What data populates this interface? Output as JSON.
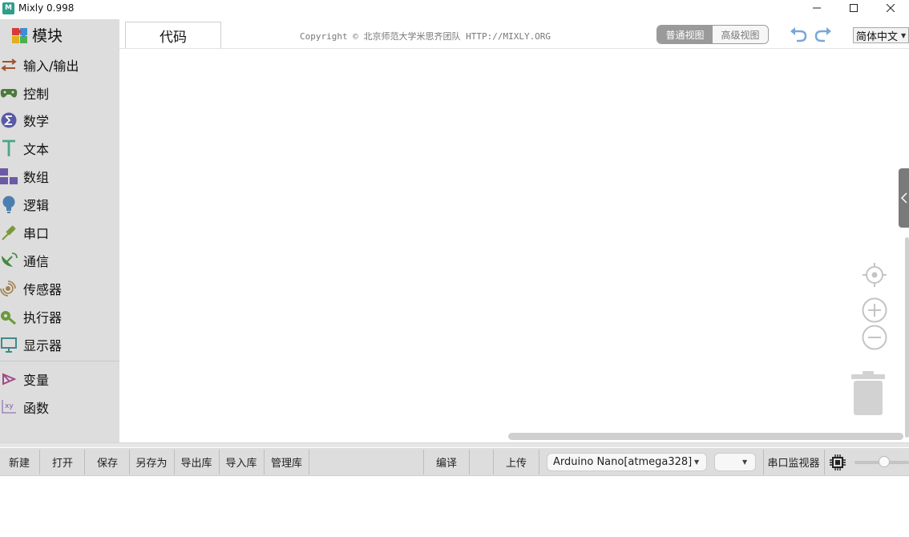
{
  "window": {
    "title": "Mixly 0.998",
    "icon": "mixly-logo-icon",
    "minimize_icon": "minimize-icon",
    "maximize_icon": "maximize-icon",
    "close_icon": "close-icon"
  },
  "sidebar": {
    "header_label": "模块",
    "header_icon": "puzzle-icon",
    "categories": [
      {
        "label": "输入/输出",
        "icon": "io-arrows-icon",
        "color": "#a0522d"
      },
      {
        "label": "控制",
        "icon": "gamepad-icon",
        "color": "#4a7a3a"
      },
      {
        "label": "数学",
        "icon": "sigma-icon",
        "color": "#5a5aa6"
      },
      {
        "label": "文本",
        "icon": "text-t-icon",
        "color": "#4ba58a"
      },
      {
        "label": "数组",
        "icon": "blocks-icon",
        "color": "#6b5aa6"
      },
      {
        "label": "逻辑",
        "icon": "bulb-icon",
        "color": "#4a7fb0"
      },
      {
        "label": "串口",
        "icon": "usb-cable-icon",
        "color": "#7a9a3a"
      },
      {
        "label": "通信",
        "icon": "satellite-dish-icon",
        "color": "#3f8a3f"
      },
      {
        "label": "传感器",
        "icon": "sensor-wave-icon",
        "color": "#a08050"
      },
      {
        "label": "执行器",
        "icon": "actuator-icon",
        "color": "#6a9a3a"
      },
      {
        "label": "显示器",
        "icon": "monitor-icon",
        "color": "#3f8a8a"
      },
      {
        "label": "变量",
        "icon": "variable-icon",
        "color": "#a04a8a"
      },
      {
        "label": "函数",
        "icon": "function-xy-icon",
        "color": "#7a5aa6"
      }
    ]
  },
  "header": {
    "code_tab": "代码",
    "copyright": "Copyright © 北京师范大学米思齐团队 HTTP://MIXLY.ORG",
    "view_normal": "普通视图",
    "view_advanced": "高级视图",
    "undo_icon": "undo-icon",
    "redo_icon": "redo-icon",
    "language": "简体中文"
  },
  "workspace": {
    "center_icon": "crosshair-icon",
    "zoom_in_icon": "zoom-in-icon",
    "zoom_out_icon": "zoom-out-icon",
    "trash_icon": "trash-icon",
    "collapse_icon": "chevron-left-icon"
  },
  "toolbar": {
    "new": "新建",
    "open": "打开",
    "save": "保存",
    "save_as": "另存为",
    "export_lib": "导出库",
    "import_lib": "导入库",
    "manage_lib": "管理库",
    "compile": "编译",
    "upload": "上传",
    "board": "Arduino Nano[atmega328]",
    "port": "",
    "serial_monitor": "串口监视器",
    "chip_icon": "chip-icon"
  }
}
